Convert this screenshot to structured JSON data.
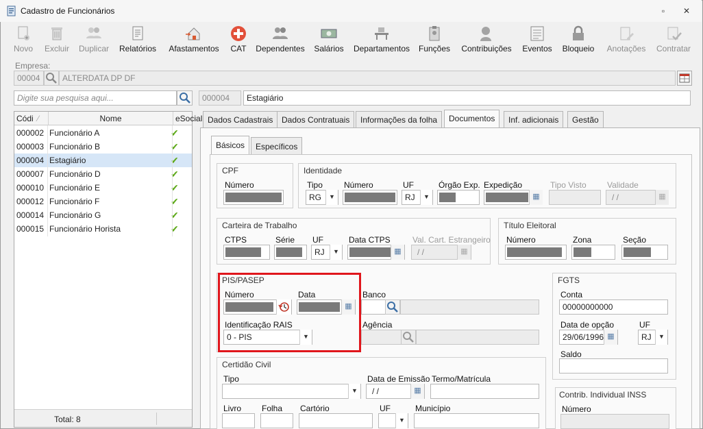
{
  "window": {
    "title": "Cadastro de Funcionários",
    "restore_glyph": "▫",
    "close_glyph": "✕"
  },
  "toolbar": {
    "buttons": [
      {
        "label": "Novo",
        "icon": "new-icon",
        "enabled": false
      },
      {
        "label": "Excluir",
        "icon": "trash-icon",
        "enabled": false
      },
      {
        "label": "Duplicar",
        "icon": "duplicate-users-icon",
        "enabled": false
      },
      {
        "label": "Relatórios",
        "icon": "report-icon",
        "enabled": true
      },
      {
        "label": "Afastamentos",
        "icon": "house-arrow-icon",
        "enabled": true
      },
      {
        "label": "CAT",
        "icon": "red-cross-icon",
        "enabled": true
      },
      {
        "label": "Dependentes",
        "icon": "people-icon",
        "enabled": true
      },
      {
        "label": "Salários",
        "icon": "money-icon",
        "enabled": true
      },
      {
        "label": "Departamentos",
        "icon": "desk-icon",
        "enabled": true
      },
      {
        "label": "Funções",
        "icon": "badge-icon",
        "enabled": true
      },
      {
        "label": "Contribuições",
        "icon": "person-head-icon",
        "enabled": true
      },
      {
        "label": "Eventos",
        "icon": "list-icon",
        "enabled": true
      },
      {
        "label": "Bloqueio",
        "icon": "lock-icon",
        "enabled": true
      },
      {
        "label": "Anotações",
        "icon": "note-pencil-icon",
        "enabled": false
      },
      {
        "label": "Contratar",
        "icon": "hire-check-icon",
        "enabled": false
      }
    ]
  },
  "empresa": {
    "label": "Empresa:",
    "code": "00004",
    "name": "ALTERDATA DP  DF"
  },
  "search": {
    "placeholder": "Digite sua pesquisa aqui..."
  },
  "employee": {
    "code": "000004",
    "name": "Estagiário"
  },
  "list": {
    "columns": [
      "Códi",
      "Nome",
      "eSocial"
    ],
    "rows": [
      {
        "code": "000002",
        "name": "Funcionário A",
        "esocial": "✔"
      },
      {
        "code": "000003",
        "name": "Funcionário B",
        "esocial": "✔"
      },
      {
        "code": "000004",
        "name": "Estagiário",
        "esocial": "✔",
        "selected": true
      },
      {
        "code": "000007",
        "name": "Funcionário D",
        "esocial": "✔"
      },
      {
        "code": "000010",
        "name": "Funcionário E",
        "esocial": "✔"
      },
      {
        "code": "000012",
        "name": "Funcionário F",
        "esocial": "✔"
      },
      {
        "code": "000014",
        "name": "Funcionário G",
        "esocial": "✔"
      },
      {
        "code": "000015",
        "name": "Funcionário Horista",
        "esocial": "✔"
      }
    ],
    "total": "Total: 8"
  },
  "tabs": [
    "Dados Cadastrais",
    "Dados Contratuais",
    "Informações da folha",
    "Documentos",
    "Inf. adicionais",
    "Gestão"
  ],
  "subtabs": [
    "Básicos",
    "Específicos"
  ],
  "cpf": {
    "title": "CPF",
    "numero_label": "Número"
  },
  "identidade": {
    "title": "Identidade",
    "tipo_label": "Tipo",
    "tipo_value": "RG",
    "numero_label": "Número",
    "uf_label": "UF",
    "uf_value": "RJ",
    "orgao_label": "Órgão Exp.",
    "expedicao_label": "Expedição",
    "tipo_visto_label": "Tipo Visto",
    "validade_label": "Validade",
    "validade_value": "/ /"
  },
  "ctps": {
    "title": "Carteira de Trabalho",
    "ctps_label": "CTPS",
    "serie_label": "Série",
    "uf_label": "UF",
    "uf_value": "RJ",
    "data_label": "Data CTPS",
    "val_label": "Val. Cart. Estrangeiro",
    "val_value": "/ /"
  },
  "titulo": {
    "title": "Título Eleitoral",
    "numero_label": "Número",
    "zona_label": "Zona",
    "secao_label": "Seção"
  },
  "pis": {
    "title": "PIS/PASEP",
    "numero_label": "Número",
    "data_label": "Data",
    "rais_label": "Identificação RAIS",
    "rais_value": "0 - PIS"
  },
  "banco": {
    "banco_label": "Banco",
    "agencia_label": "Agência"
  },
  "fgts": {
    "title": "FGTS",
    "conta_label": "Conta",
    "conta_value": "00000000000",
    "opcao_label": "Data de opção",
    "opcao_value": "29/06/1996",
    "uf_label": "UF",
    "uf_value": "RJ",
    "saldo_label": "Saldo"
  },
  "certidao": {
    "title": "Certidão Civil",
    "tipo_label": "Tipo",
    "emissao_label": "Data de Emissão",
    "emissao_value": "/ /",
    "termo_label": "Termo/Matrícula",
    "livro_label": "Livro",
    "folha_label": "Folha",
    "cartorio_label": "Cartório",
    "uf_label": "UF",
    "municipio_label": "Município"
  },
  "inss": {
    "title": "Contrib. Individual INSS",
    "numero_label": "Número"
  },
  "colors": {
    "highlight_box": "#e0161c",
    "check": "#5da918",
    "selected_row": "#d6e6f7"
  }
}
